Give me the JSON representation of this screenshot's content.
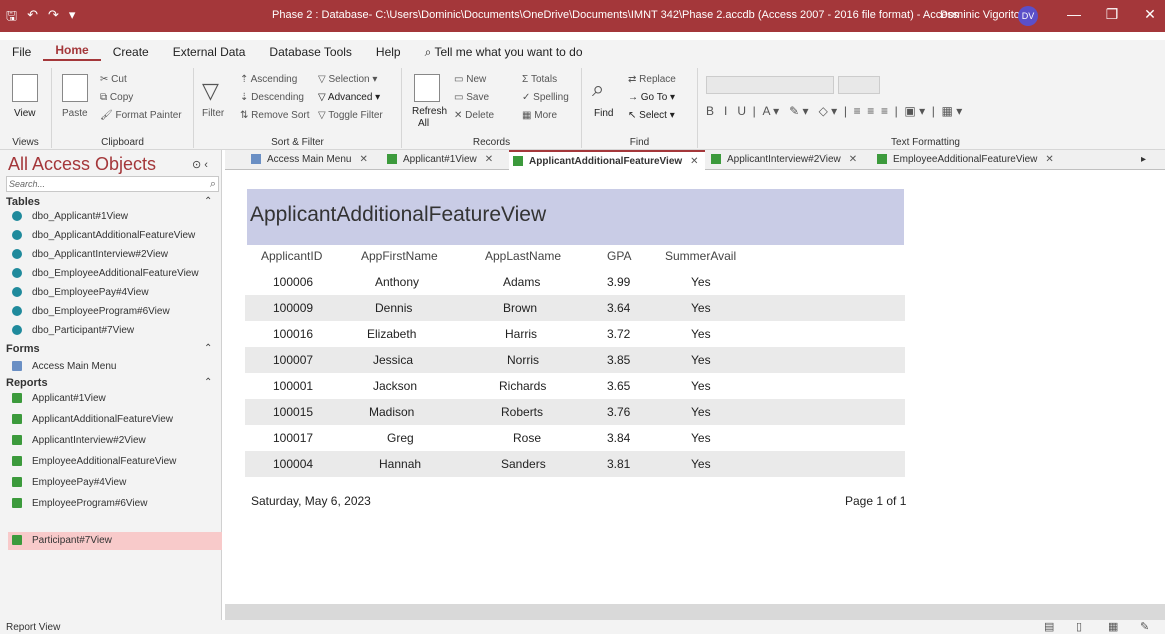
{
  "titlebar": {
    "title": "Phase 2 : Database- C:\\Users\\Dominic\\Documents\\OneDrive\\Documents\\IMNT 342\\Phase 2.accdb (Access 2007 - 2016 file format)  -  Access",
    "user": "Dominic Vigorito",
    "initials": "DV"
  },
  "menu": [
    "File",
    "Home",
    "Create",
    "External Data",
    "Database Tools",
    "Help",
    "Tell me what you want to do"
  ],
  "ribbon": {
    "views": {
      "label": "Views",
      "view": "View"
    },
    "clipboard": {
      "label": "Clipboard",
      "paste": "Paste",
      "cut": "Cut",
      "copy": "Copy",
      "format_painter": "Format Painter"
    },
    "sortfilter": {
      "label": "Sort & Filter",
      "filter": "Filter",
      "ascending": "Ascending",
      "descending": "Descending",
      "remove_sort": "Remove Sort",
      "selection": "Selection",
      "advanced": "Advanced",
      "toggle_filter": "Toggle Filter"
    },
    "records": {
      "label": "Records",
      "refresh": "Refresh",
      "refresh_all": "All",
      "new": "New",
      "save": "Save",
      "delete": "Delete",
      "totals": "Totals",
      "spelling": "Spelling",
      "more": "More"
    },
    "find": {
      "label": "Find",
      "find": "Find",
      "replace": "Replace",
      "goto": "Go To",
      "select": "Select"
    },
    "text_formatting": {
      "label": "Text Formatting"
    }
  },
  "sidebar": {
    "title": "All Access Objects",
    "search_placeholder": "Search...",
    "tables_label": "Tables",
    "tables": [
      "dbo_Applicant#1View",
      "dbo_ApplicantAdditionalFeatureView",
      "dbo_ApplicantInterview#2View",
      "dbo_EmployeeAdditionalFeatureView",
      "dbo_EmployeePay#4View",
      "dbo_EmployeeProgram#6View",
      "dbo_Participant#7View"
    ],
    "forms_label": "Forms",
    "forms": [
      "Access Main Menu"
    ],
    "reports_label": "Reports",
    "reports": [
      "Applicant#1View",
      "ApplicantAdditionalFeatureView",
      "ApplicantInterview#2View",
      "EmployeeAdditionalFeatureView",
      "EmployeePay#4View",
      "EmployeeProgram#6View",
      "Participant#7View"
    ]
  },
  "tabs": [
    "Access Main Menu",
    "Applicant#1View",
    "ApplicantAdditionalFeatureView",
    "ApplicantInterview#2View",
    "EmployeeAdditionalFeatureView"
  ],
  "report": {
    "title": "ApplicantAdditionalFeatureView",
    "columns": [
      "ApplicantID",
      "AppFirstName",
      "AppLastName",
      "GPA",
      "SummerAvail"
    ],
    "rows": [
      [
        "100006",
        "Anthony",
        "Adams",
        "3.99",
        "Yes"
      ],
      [
        "100009",
        "Dennis",
        "Brown",
        "3.64",
        "Yes"
      ],
      [
        "100016",
        "Elizabeth",
        "Harris",
        "3.72",
        "Yes"
      ],
      [
        "100007",
        "Jessica",
        "Norris",
        "3.85",
        "Yes"
      ],
      [
        "100001",
        "Jackson",
        "Richards",
        "3.65",
        "Yes"
      ],
      [
        "100015",
        "Madison",
        "Roberts",
        "3.76",
        "Yes"
      ],
      [
        "100017",
        "Greg",
        "Rose",
        "3.84",
        "Yes"
      ],
      [
        "100004",
        "Hannah",
        "Sanders",
        "3.81",
        "Yes"
      ]
    ],
    "date": "Saturday, May 6, 2023",
    "page": "Page 1 of 1"
  },
  "status": {
    "text": "Report View"
  },
  "colors": {
    "accent": "#a4373a",
    "header_band": "#c9cce6",
    "row_alt": "#eaeaea",
    "selected_item": "#f8caca"
  }
}
